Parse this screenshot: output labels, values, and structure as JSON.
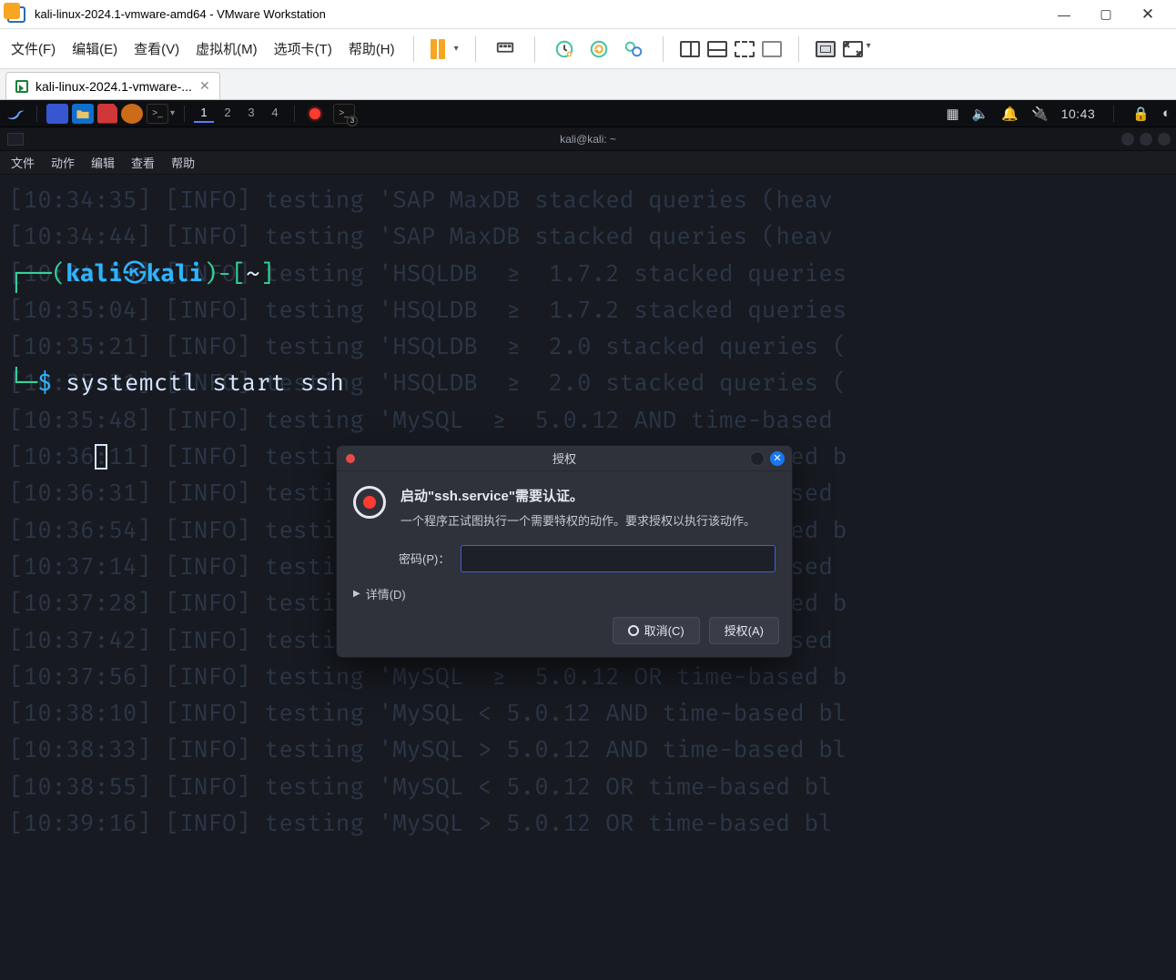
{
  "host_window": {
    "title": "kali-linux-2024.1-vmware-amd64 - VMware Workstation",
    "controls": {
      "minimize": "—",
      "maximize": "▢",
      "close": "✕"
    }
  },
  "vm_menu": {
    "items": [
      "文件(F)",
      "编辑(E)",
      "查看(V)",
      "虚拟机(M)",
      "选项卡(T)",
      "帮助(H)"
    ]
  },
  "vm_tab": {
    "label": "kali-linux-2024.1-vmware-...",
    "close": "✕"
  },
  "kali_panel": {
    "workspaces": [
      "1",
      "2",
      "3",
      "4"
    ],
    "active_workspace": 0,
    "tray": {
      "time": "10:43"
    }
  },
  "terminal": {
    "title": "kali@kali: ~",
    "menu": [
      "文件",
      "动作",
      "编辑",
      "查看",
      "帮助"
    ],
    "prompt": {
      "user": "kali",
      "host": "kali",
      "cwd": "~",
      "dollar": "$",
      "command": "systemctl start ssh"
    },
    "background_lines": [
      "[10:34:35] [INFO] testing 'SAP MaxDB stacked queries (heav",
      "[10:34:44] [INFO] testing 'SAP MaxDB stacked queries (heav",
      "[10:34:53] [INFO] testing 'HSQLDB  ≥  1.7.2 stacked queries",
      "[10:35:04] [INFO] testing 'HSQLDB  ≥  1.7.2 stacked queries",
      "[10:35:21] [INFO] testing 'HSQLDB  ≥  2.0 stacked queries (",
      "[10:35:31] [INFO] testing 'HSQLDB  ≥  2.0 stacked queries (",
      "[10:35:48] [INFO] testing 'MySQL  ≥  5.0.12 AND time-based ",
      "[10:36:11] [INFO] testing 'MySQL  ≥  5.0.12 OR time-based b",
      "[10:36:31] [INFO] testing 'MySQL  ≥  5.0.12 AND time-based ",
      "[10:36:54] [INFO] testing 'MySQL  ≥  5.0.12 OR time-based b",
      "[10:37:14] [INFO] testing 'MySQL  ≥  5.0.12 AND time-based ",
      "[10:37:28] [INFO] testing 'MySQL  ≥  5.0.12 OR time-based b",
      "[10:37:42] [INFO] testing 'MySQL  ≥  5.0.12 AND time-based ",
      "[10:37:56] [INFO] testing 'MySQL  ≥  5.0.12 OR time-based b",
      "[10:38:10] [INFO] testing 'MySQL < 5.0.12 AND time-based bl",
      "[10:38:33] [INFO] testing 'MySQL > 5.0.12 AND time-based bl",
      "[10:38:55] [INFO] testing 'MySQL < 5.0.12 OR time-based bl",
      "[10:39:16] [INFO] testing 'MySQL > 5.0.12 OR time-based bl"
    ]
  },
  "auth_dialog": {
    "title": "授权",
    "heading": "启动\"ssh.service\"需要认证。",
    "subtext": "一个程序正试图执行一个需要特权的动作。要求授权以执行该动作。",
    "password_label": "密码(P)：",
    "password_value": "",
    "details_label": "详情(D)",
    "cancel_label": "取消(C)",
    "authorize_label": "授权(A)"
  }
}
